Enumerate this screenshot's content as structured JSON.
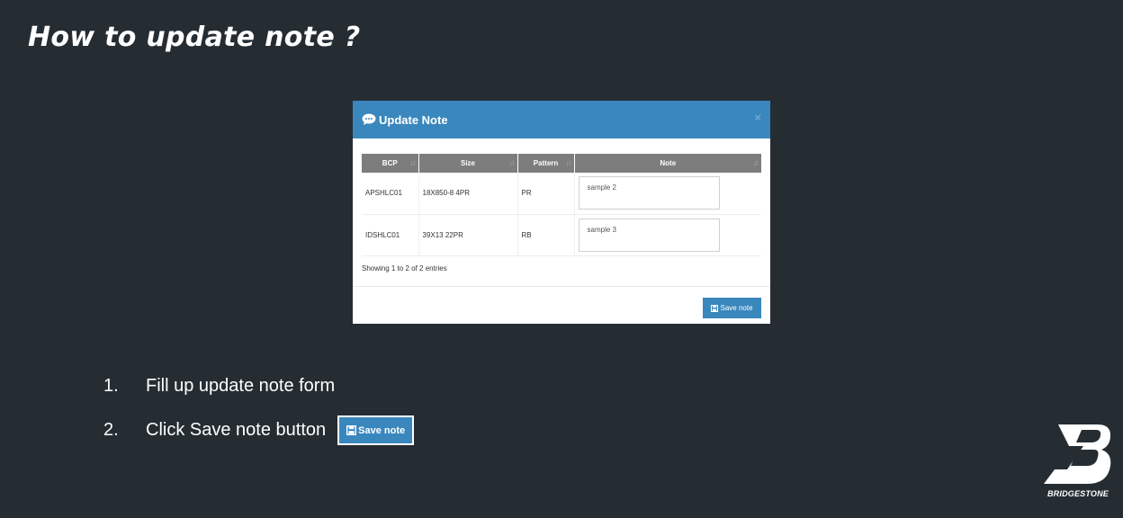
{
  "slide": {
    "title": "How to update note ?"
  },
  "modal": {
    "title": "Update Note",
    "close_label": "×",
    "columns": [
      "BCP",
      "Size",
      "Pattern",
      "Note"
    ],
    "rows": [
      {
        "bcp": "APSHLC01",
        "size": "18X850-8 4PR",
        "pattern": "PR",
        "note": "sample 2"
      },
      {
        "bcp": "IDSHLC01",
        "size": "39X13 22PR",
        "pattern": "RB",
        "note": "sample 3"
      }
    ],
    "entries_info": "Showing 1 to 2 of 2 entries",
    "save_label": "Save note",
    "header_color": "#3a87bd"
  },
  "steps": [
    {
      "num": "1.",
      "text": "Fill up update note form"
    },
    {
      "num": "2.",
      "text": "Click Save note button"
    }
  ],
  "step_button_label": "Save note",
  "logo": {
    "text": "BRIDGESTONE"
  }
}
